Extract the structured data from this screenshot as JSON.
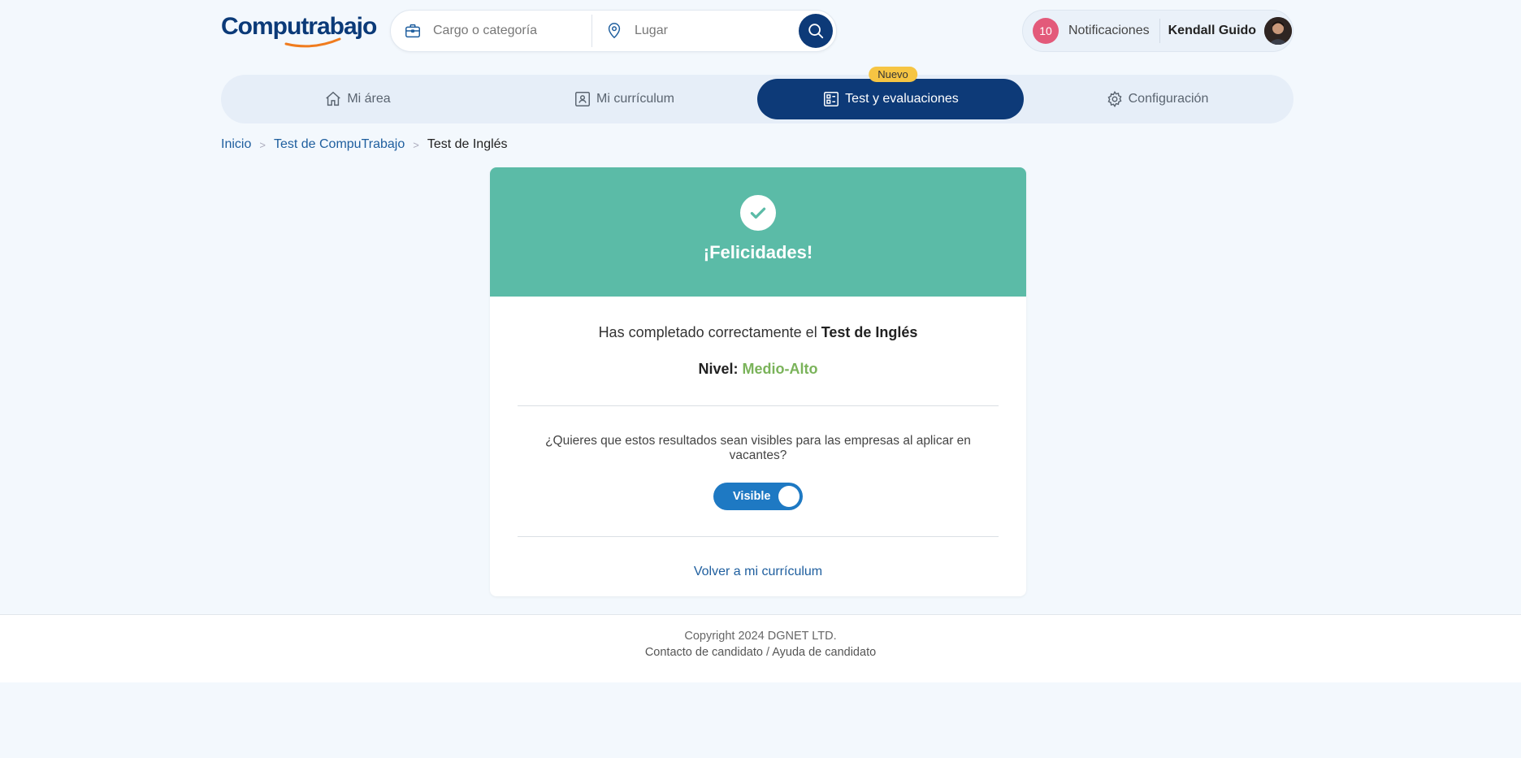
{
  "header": {
    "logo_text": "Computrabajo",
    "search": {
      "job_placeholder": "Cargo o categoría",
      "location_placeholder": "Lugar"
    },
    "notifications": {
      "count": "10",
      "label": "Notificaciones"
    },
    "user_name": "Kendall Guido"
  },
  "nav": {
    "items": [
      {
        "label": "Mi área",
        "icon": "home-icon"
      },
      {
        "label": "Mi currículum",
        "icon": "resume-icon"
      },
      {
        "label": "Test y evaluaciones",
        "icon": "test-icon",
        "badge": "Nuevo",
        "active": true
      },
      {
        "label": "Configuración",
        "icon": "gear-icon"
      }
    ]
  },
  "breadcrumb": {
    "items": [
      "Inicio",
      "Test de CompuTrabajo",
      "Test de Inglés"
    ]
  },
  "result": {
    "title": "¡Felicidades!",
    "completed_prefix": "Has completado correctamente el",
    "test_name": "Test de Inglés",
    "level_label": "Nivel:",
    "level_value": "Medio-Alto",
    "question": "¿Quieres que estos resultados sean visibles para las empresas al aplicar en vacantes?",
    "toggle_label": "Visible",
    "back_link": "Volver a mi currículum"
  },
  "footer": {
    "copyright": "Copyright 2024 DGNET LTD.",
    "contact": "Contacto de candidato",
    "separator": "/",
    "help": "Ayuda de candidato"
  },
  "colors": {
    "brand": "#0d3a78",
    "success": "#5bbba7",
    "level": "#7ab35a",
    "notification": "#e35a7a",
    "badge": "#f6c543",
    "toggle": "#1e79c3"
  }
}
